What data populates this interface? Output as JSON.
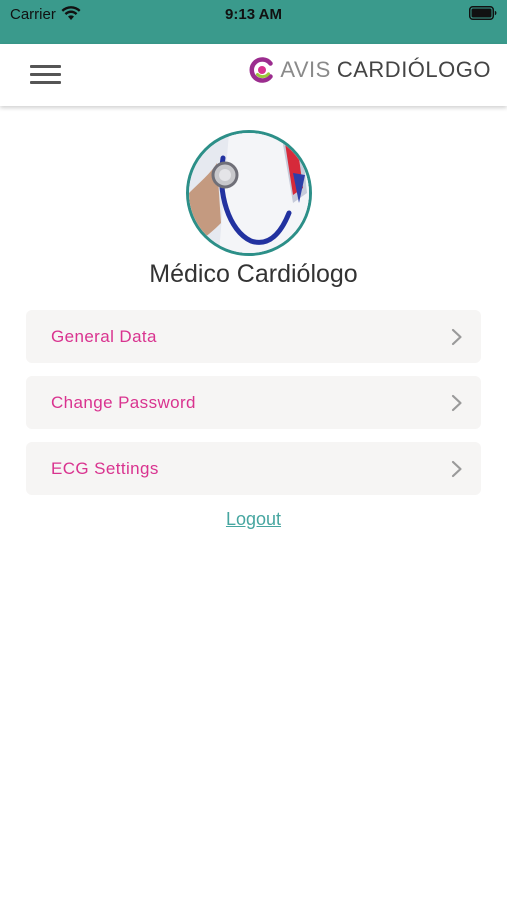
{
  "status_bar": {
    "carrier": "Carrier",
    "time": "9:13 AM",
    "icons": [
      "wifi-icon",
      "battery-icon"
    ],
    "background": "#3a9a8c"
  },
  "nav_bar": {
    "menu_icon": "hamburger-menu-icon",
    "brand_prefix": "AVIS",
    "brand_name": "CARDIÓLOGO",
    "logo_colors": [
      "#9b2c8e",
      "#d9338f",
      "#9cc93b"
    ]
  },
  "profile": {
    "avatar_icon": "doctor-stethoscope-avatar",
    "name": "Médico Cardiólogo"
  },
  "menu": {
    "items": [
      {
        "label": "General Data",
        "icon": "chevron-right-icon"
      },
      {
        "label": "Change Password",
        "icon": "chevron-right-icon"
      },
      {
        "label": "ECG Settings",
        "icon": "chevron-right-icon"
      }
    ]
  },
  "logout_label": "Logout",
  "colors": {
    "accent_pink": "#d9338f",
    "link_teal": "#46a6a0",
    "row_background": "#f6f5f4"
  }
}
